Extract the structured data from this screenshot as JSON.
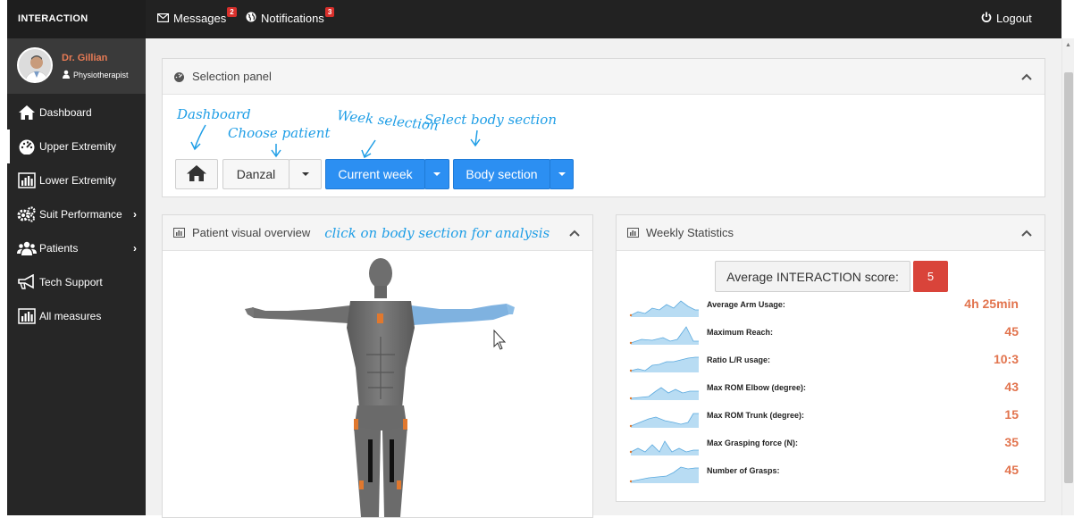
{
  "app": {
    "brand": "INTERACTION"
  },
  "topbar": {
    "messages_label": "Messages",
    "messages_count": "2",
    "notifications_label": "Notifications",
    "notifications_count": "3",
    "logout_label": "Logout"
  },
  "profile": {
    "name": "Dr. Gillian",
    "role": "Physiotherapist"
  },
  "sidebar": {
    "items": [
      {
        "label": "Dashboard",
        "icon": "home-icon"
      },
      {
        "label": "Upper Extremity",
        "icon": "dashboard-gauge-icon"
      },
      {
        "label": "Lower Extremity",
        "icon": "bar-chart-icon"
      },
      {
        "label": "Suit Performance",
        "icon": "gears-icon"
      },
      {
        "label": "Patients",
        "icon": "users-icon"
      },
      {
        "label": "Tech Support",
        "icon": "bullhorn-icon"
      },
      {
        "label": "All measures",
        "icon": "bar-chart-icon"
      }
    ]
  },
  "selection_panel": {
    "title": "Selection panel",
    "annotations": {
      "dashboard": "Dashboard",
      "choose_patient": "Choose patient",
      "week_selection": "Week selection",
      "select_body": "Select body section"
    },
    "patient_value": "Danzal",
    "week_label": "Current week",
    "body_label": "Body section"
  },
  "overview_panel": {
    "title": "Patient visual overview",
    "hint": "click on body section for analysis"
  },
  "stats_panel": {
    "title": "Weekly Statistics",
    "score_label": "Average INTERACTION score:",
    "score_value": "5",
    "rows": [
      {
        "label": "Average Arm Usage:",
        "value": "4h 25min"
      },
      {
        "label": "Maximum Reach:",
        "value": "45"
      },
      {
        "label": "Ratio L/R usage:",
        "value": "10:3"
      },
      {
        "label": "Max ROM Elbow (degree):",
        "value": "43"
      },
      {
        "label": "Max ROM Trunk (degree):",
        "value": "15"
      },
      {
        "label": "Max Grasping force (N):",
        "value": "35"
      },
      {
        "label": "Number of Grasps:",
        "value": "45"
      }
    ]
  },
  "colors": {
    "accent_blue": "#2c8ff2",
    "highlight_orange": "#e2744e",
    "score_red": "#d9443a",
    "annotation_blue": "#1f9ee6",
    "sidebar_bg": "#262626"
  }
}
